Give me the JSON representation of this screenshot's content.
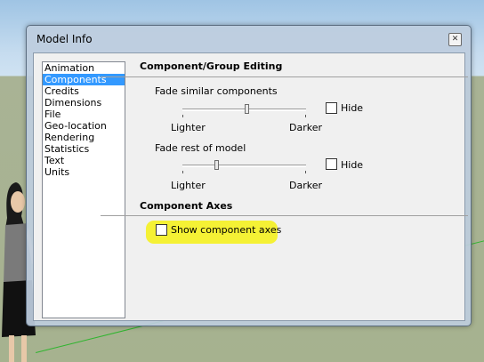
{
  "window": {
    "title": "Model Info",
    "close_icon": "close-icon"
  },
  "sidebar": {
    "items": [
      {
        "label": "Animation",
        "selected": false
      },
      {
        "label": "Components",
        "selected": true
      },
      {
        "label": "Credits",
        "selected": false
      },
      {
        "label": "Dimensions",
        "selected": false
      },
      {
        "label": "File",
        "selected": false
      },
      {
        "label": "Geo-location",
        "selected": false
      },
      {
        "label": "Rendering",
        "selected": false
      },
      {
        "label": "Statistics",
        "selected": false
      },
      {
        "label": "Text",
        "selected": false
      },
      {
        "label": "Units",
        "selected": false
      }
    ]
  },
  "component_group_editing": {
    "title": "Component/Group Editing",
    "fade_similar": {
      "label": "Fade similar components",
      "slider_value": 0.52,
      "min_label": "Lighter",
      "max_label": "Darker",
      "hide_label": "Hide",
      "hide_checked": false
    },
    "fade_rest": {
      "label": "Fade rest of model",
      "slider_value": 0.27,
      "min_label": "Lighter",
      "max_label": "Darker",
      "hide_label": "Hide",
      "hide_checked": false
    }
  },
  "component_axes": {
    "title": "Component Axes",
    "show_axes_label": "Show component axes",
    "show_axes_checked": false
  },
  "colors": {
    "selection": "#3399ff",
    "highlight": "#f4f02a",
    "axis_green": "#2fb52f"
  }
}
